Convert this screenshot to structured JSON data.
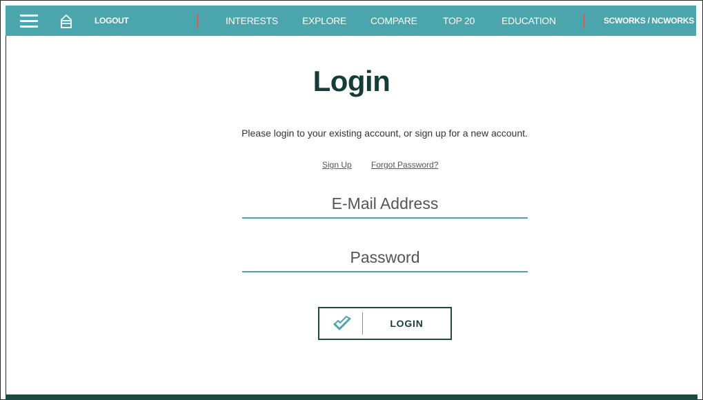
{
  "nav": {
    "logout": "LOGOUT",
    "items": [
      "INTERESTS",
      "EXPLORE",
      "COMPARE",
      "TOP 20",
      "EDUCATION"
    ],
    "right": "SCWORKS / NCWORKS",
    "colors": {
      "bar": "#4aa5ad",
      "separator": "#d9503f"
    },
    "icons": [
      "hamburger-menu-icon",
      "home-icon"
    ]
  },
  "page": {
    "title": "Login",
    "intro": "Please login to your existing account, or sign up for a new account.",
    "signup_link": "Sign Up",
    "forgot_link": "Forgot Password?"
  },
  "form": {
    "email_placeholder": "E-Mail Address",
    "email_value": "",
    "password_placeholder": "Password",
    "password_value": ""
  },
  "login_button": {
    "label": "LOGIN",
    "icon": "checkmark-icon",
    "border_color": "#1f4a44",
    "accent_color": "#4aa5ad"
  }
}
